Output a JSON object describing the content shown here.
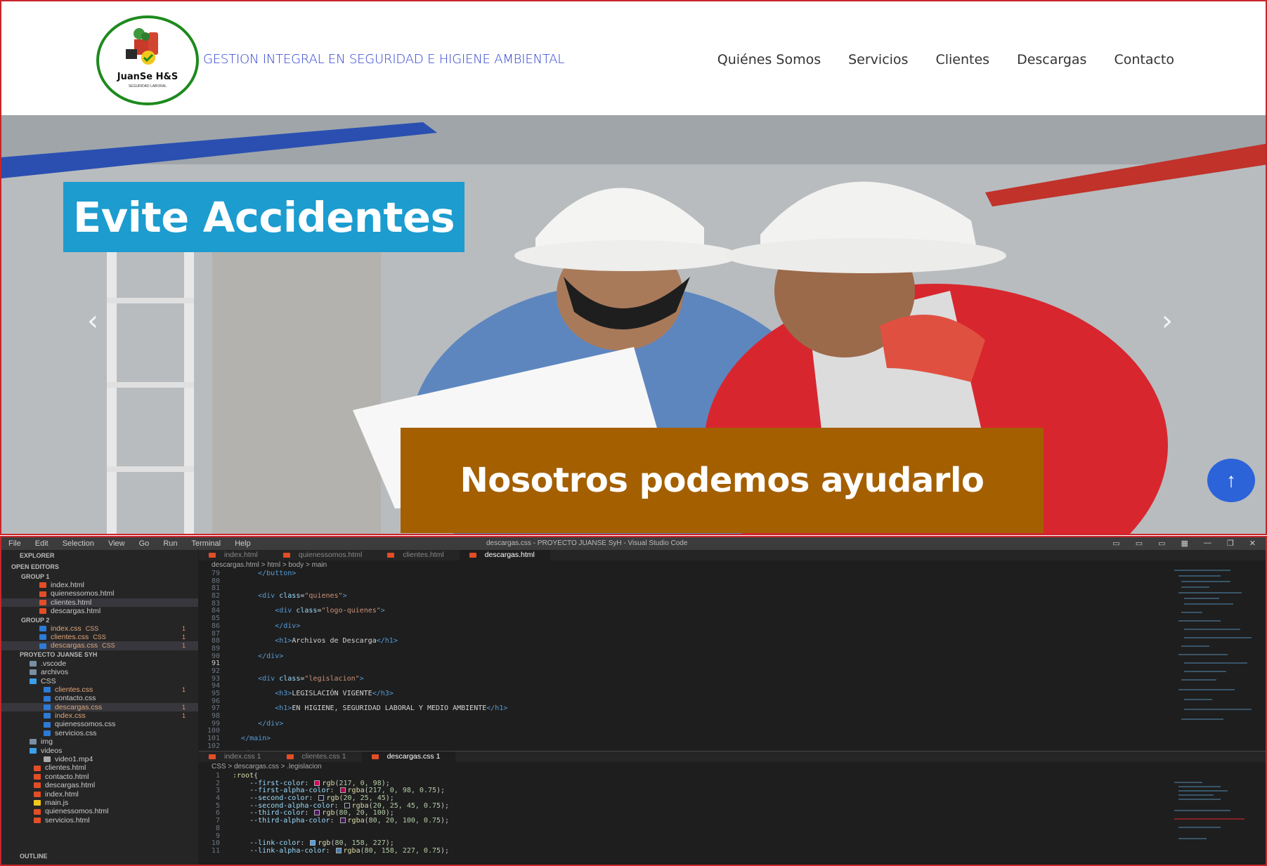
{
  "site": {
    "logo_text": "JuanSe H&S",
    "logo_sub": "SEGURIDAD LABORAL",
    "title": "GESTION INTEGRAL EN SEGURIDAD E HIGIENE AMBIENTAL",
    "nav": [
      "Quiénes Somos",
      "Servicios",
      "Clientes",
      "Descargas",
      "Contacto"
    ],
    "hero_title": "Evite Accidentes",
    "hero_subtitle": "Nosotros podemos ayudarlo",
    "prev_arrow": "‹",
    "next_arrow": "›",
    "to_top": "↑",
    "colors": {
      "title_blue": "#2d3fd0",
      "hero_title_bg": "#1c9ccf",
      "hero_subtitle_bg": "#a45f00",
      "to_top_bg": "#2c63d8",
      "logo_ring": "#1d8a1d"
    }
  },
  "vscode": {
    "menu": [
      "File",
      "Edit",
      "Selection",
      "View",
      "Go",
      "Run",
      "Terminal",
      "Help"
    ],
    "window_title": "descargas.css - PROYECTO JUANSE SyH - Visual Studio Code",
    "explorer_label": "EXPLORER",
    "open_editors_label": "OPEN EDITORS",
    "group1_label": "GROUP 1",
    "group1": [
      "index.html",
      "quienessomos.html",
      "clientes.html",
      "descargas.html"
    ],
    "group2_label": "GROUP 2",
    "group2": [
      {
        "name": "index.css",
        "suffix": "CSS",
        "badge": "1"
      },
      {
        "name": "clientes.css",
        "suffix": "CSS",
        "badge": "1"
      },
      {
        "name": "descargas.css",
        "suffix": "CSS",
        "badge": "1"
      }
    ],
    "project_label": "PROYECTO JUANSE SYH",
    "tree": [
      {
        "name": ".vscode",
        "type": "folder"
      },
      {
        "name": "archivos",
        "type": "folder"
      },
      {
        "name": "CSS",
        "type": "folder-open"
      },
      {
        "name": "clientes.css",
        "type": "css",
        "badge": "1"
      },
      {
        "name": "contacto.css",
        "type": "css"
      },
      {
        "name": "descargas.css",
        "type": "css",
        "badge": "1"
      },
      {
        "name": "index.css",
        "type": "css",
        "badge": "1"
      },
      {
        "name": "quienessomos.css",
        "type": "css"
      },
      {
        "name": "servicios.css",
        "type": "css"
      },
      {
        "name": "img",
        "type": "folder"
      },
      {
        "name": "videos",
        "type": "folder-open"
      },
      {
        "name": "video1.mp4",
        "type": "file"
      },
      {
        "name": "clientes.html",
        "type": "html"
      },
      {
        "name": "contacto.html",
        "type": "html"
      },
      {
        "name": "descargas.html",
        "type": "html"
      },
      {
        "name": "index.html",
        "type": "html"
      },
      {
        "name": "main.js",
        "type": "js"
      },
      {
        "name": "quienessomos.html",
        "type": "html"
      },
      {
        "name": "servicios.html",
        "type": "html"
      }
    ],
    "outline_label": "OUTLINE",
    "top_tabs": [
      "index.html",
      "quienessomos.html",
      "clientes.html",
      "descargas.html"
    ],
    "top_breadcrumb": "descargas.html > html > body > main",
    "bottom_tabs": [
      "index.css 1",
      "clientes.css 1",
      "descargas.css 1"
    ],
    "bottom_breadcrumb": "CSS > descargas.css > .legislacion"
  }
}
